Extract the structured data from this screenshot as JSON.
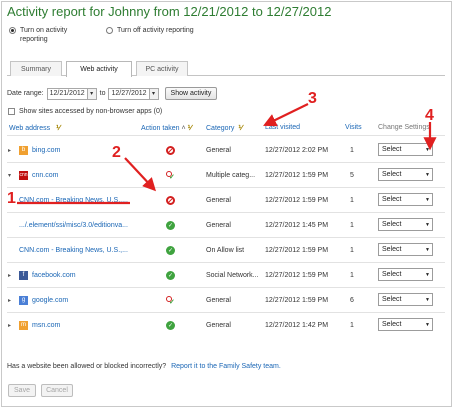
{
  "title": "Activity report for Johnny from 12/21/2012 to 12/27/2012",
  "radios": {
    "on": "Turn on activity reporting",
    "off": "Turn off activity reporting"
  },
  "tabs": [
    "Summary",
    "Web activity",
    "PC activity"
  ],
  "filters": {
    "date_range_label": "Date range:",
    "from": "12/21/2012",
    "to_label": "to",
    "to": "12/27/2012",
    "show_button": "Show activity",
    "checkbox_label": "Show sites accessed by non-browser apps (0)"
  },
  "columns": {
    "web_address": "Web address",
    "action": "Action taken",
    "category": "Category",
    "last_visited": "Last visited",
    "visits": "Visits",
    "change": "Change Settings"
  },
  "rows": [
    {
      "site": "bing.com",
      "icon": "bing-icon",
      "action": "blocked",
      "category": "General",
      "last": "12/27/2012 2:02 PM",
      "visits": "1",
      "setting": "Select"
    },
    {
      "site": "cnn.com",
      "icon": "cnn-icon",
      "action": "warned",
      "category": "Multiple categ...",
      "last": "12/27/2012 1:59 PM",
      "visits": "5",
      "setting": "Select"
    },
    {
      "site": "CNN.com - Breaking News, U.S.,...",
      "icon": "",
      "action": "blocked",
      "category": "General",
      "last": "12/27/2012 1:59 PM",
      "visits": "1",
      "setting": "Select"
    },
    {
      "site": ".../.element/ssi/misc/3.0/editionva...",
      "icon": "",
      "action": "allowed",
      "category": "General",
      "last": "12/27/2012 1:45 PM",
      "visits": "1",
      "setting": "Select"
    },
    {
      "site": "CNN.com - Breaking News, U.S.,...",
      "icon": "",
      "action": "allowed",
      "category": "On Allow list",
      "last": "12/27/2012 1:59 PM",
      "visits": "1",
      "setting": "Select"
    },
    {
      "site": "facebook.com",
      "icon": "facebook-icon",
      "action": "allowed",
      "category": "Social Network...",
      "last": "12/27/2012 1:59 PM",
      "visits": "1",
      "setting": "Select"
    },
    {
      "site": "google.com",
      "icon": "google-icon",
      "action": "warned",
      "category": "General",
      "last": "12/27/2012 1:59 PM",
      "visits": "6",
      "setting": "Select"
    },
    {
      "site": "msn.com",
      "icon": "msn-icon",
      "action": "allowed",
      "category": "General",
      "last": "12/27/2012 1:42 PM",
      "visits": "1",
      "setting": "Select"
    }
  ],
  "footer": {
    "question": "Has a website been allowed or blocked incorrectly?",
    "link": "Report it to the Family Safety team.",
    "save": "Save",
    "cancel": "Cancel"
  },
  "annotations": [
    "1",
    "2",
    "3",
    "4"
  ],
  "colors": {
    "title_green": "#2e7d32",
    "link_blue": "#1a66b5",
    "annotation_red": "#e02020",
    "blocked_red": "#d32020",
    "allowed_green": "#3fa33f"
  }
}
